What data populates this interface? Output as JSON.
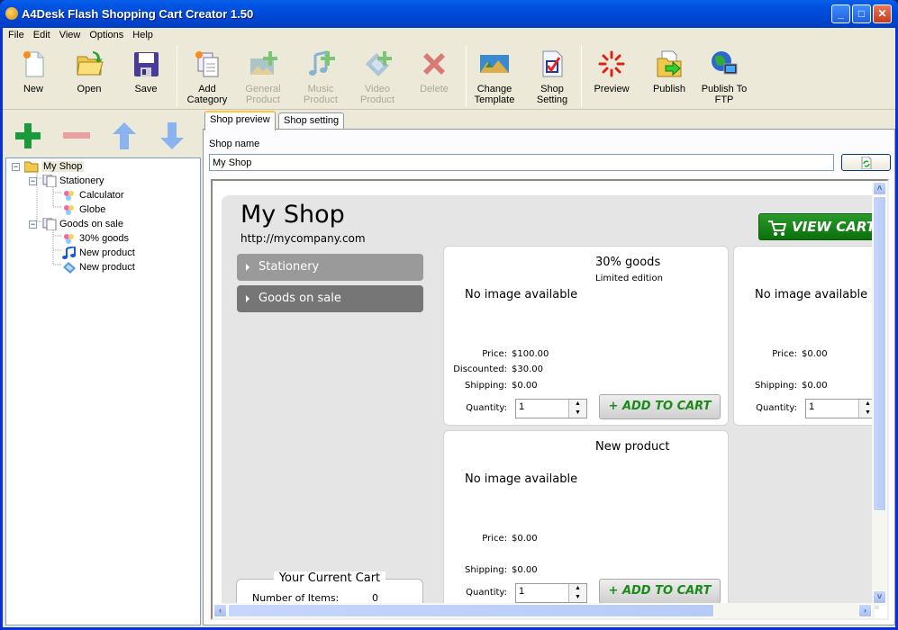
{
  "window": {
    "title": "A4Desk Flash Shopping Cart Creator 1.50",
    "controls": {
      "minimize": "_",
      "maximize": "□",
      "close": "✕"
    }
  },
  "menu": [
    "File",
    "Edit",
    "View",
    "Options",
    "Help"
  ],
  "toolbar": {
    "new": "New",
    "open": "Open",
    "save": "Save",
    "add_category": "Add Category",
    "general_product": "General Product",
    "music_product": "Music Product",
    "video_product": "Video Product",
    "delete": "Delete",
    "change_template": "Change Template",
    "shop_setting": "Shop Setting",
    "preview": "Preview",
    "publish": "Publish",
    "publish_ftp": "Publish To FTP"
  },
  "tree": {
    "root": "My Shop",
    "items": [
      {
        "label": "Stationery",
        "type": "category"
      },
      {
        "label": "Calculator",
        "type": "general-product"
      },
      {
        "label": "Globe",
        "type": "general-product"
      },
      {
        "label": "Goods on sale",
        "type": "category"
      },
      {
        "label": "30% goods",
        "type": "general-product"
      },
      {
        "label": "New product",
        "type": "music-product"
      },
      {
        "label": "New product",
        "type": "video-product"
      }
    ]
  },
  "tabs": {
    "preview": "Shop preview",
    "setting": "Shop setting"
  },
  "form": {
    "shop_name_label": "Shop name",
    "shop_name_value": "My Shop"
  },
  "shop": {
    "title": "My Shop",
    "url": "http://mycompany.com",
    "view_cart": "VIEW CART",
    "categories": [
      "Stationery",
      "Goods on sale"
    ],
    "add_to_cart": "+ ADD TO CART",
    "no_image": "No image available",
    "labels": {
      "price": "Price:",
      "discounted": "Discounted:",
      "shipping": "Shipping:",
      "quantity": "Quantity:"
    },
    "products": [
      {
        "name": "30% goods",
        "desc": "Limited edition",
        "price": "$100.00",
        "discounted": "$30.00",
        "shipping": "$0.00",
        "quantity": "1"
      },
      {
        "name": "",
        "desc": "",
        "price": "$0.00",
        "shipping": "$0.00",
        "quantity": "1"
      },
      {
        "name": "New product",
        "desc": "",
        "price": "$0.00",
        "shipping": "$0.00",
        "quantity": "1"
      }
    ],
    "cart": {
      "title": "Your Current Cart",
      "items_label": "Number of Items:",
      "items_value": "0"
    }
  },
  "colors": {
    "titlebar": "#0054e3",
    "view_cart_green": "#0b700b",
    "add_cart_text": "#1a8a1a",
    "cat1": "#9a9a9a",
    "cat2": "#767676"
  }
}
